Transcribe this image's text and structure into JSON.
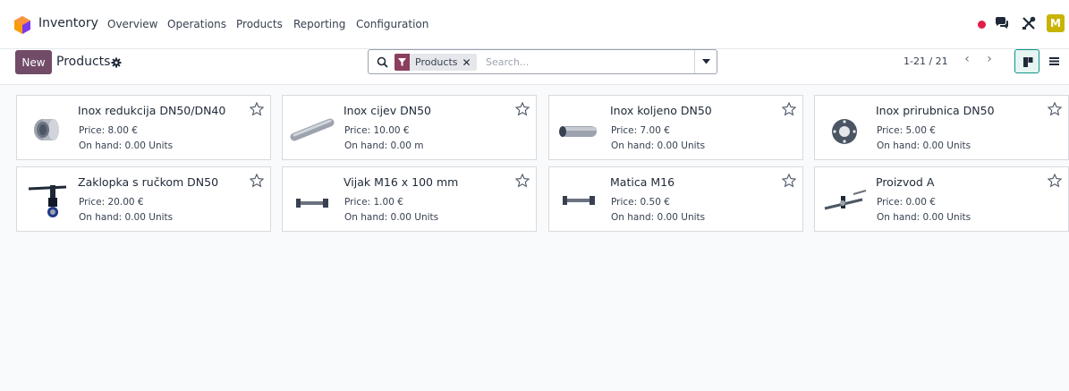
{
  "app": {
    "name": "Inventory",
    "nav": [
      "Overview",
      "Operations",
      "Products",
      "Reporting",
      "Configuration"
    ],
    "avatar_initial": "M",
    "accent": "#714b67"
  },
  "control": {
    "new_label": "New",
    "breadcrumb": "Products",
    "search": {
      "facet_label": "Products",
      "facet_remove": "✕",
      "placeholder": "Search..."
    },
    "pager": "1-21 / 21",
    "pager_prev": "‹",
    "pager_next": "›"
  },
  "products": [
    {
      "name": "Inox redukcija DN50/DN40",
      "price": "Price: 8.00 €",
      "onhand": "On hand: 0.00 Units",
      "icon": "reducer-icon"
    },
    {
      "name": "Inox cijev DN50",
      "price": "Price: 10.00 €",
      "onhand": "On hand: 0.00 m",
      "icon": "pipe-icon"
    },
    {
      "name": "Inox koljeno DN50",
      "price": "Price: 7.00 €",
      "onhand": "On hand: 0.00 Units",
      "icon": "elbow-icon"
    },
    {
      "name": "Inox prirubnica DN50",
      "price": "Price: 5.00 €",
      "onhand": "On hand: 0.00 Units",
      "icon": "flange-icon"
    },
    {
      "name": "Zaklopka s ručkom DN50",
      "price": "Price: 20.00 €",
      "onhand": "On hand: 0.00 Units",
      "icon": "valve-icon"
    },
    {
      "name": "Vijak M16 x 100 mm",
      "price": "Price: 1.00 €",
      "onhand": "On hand: 0.00 Units",
      "icon": "bolt-icon"
    },
    {
      "name": "Matica M16",
      "price": "Price: 0.50 €",
      "onhand": "On hand: 0.00 Units",
      "icon": "nut-icon"
    },
    {
      "name": "Proizvod A",
      "price": "Price: 0.00 €",
      "onhand": "On hand: 0.00 Units",
      "icon": "assembly-icon"
    }
  ]
}
